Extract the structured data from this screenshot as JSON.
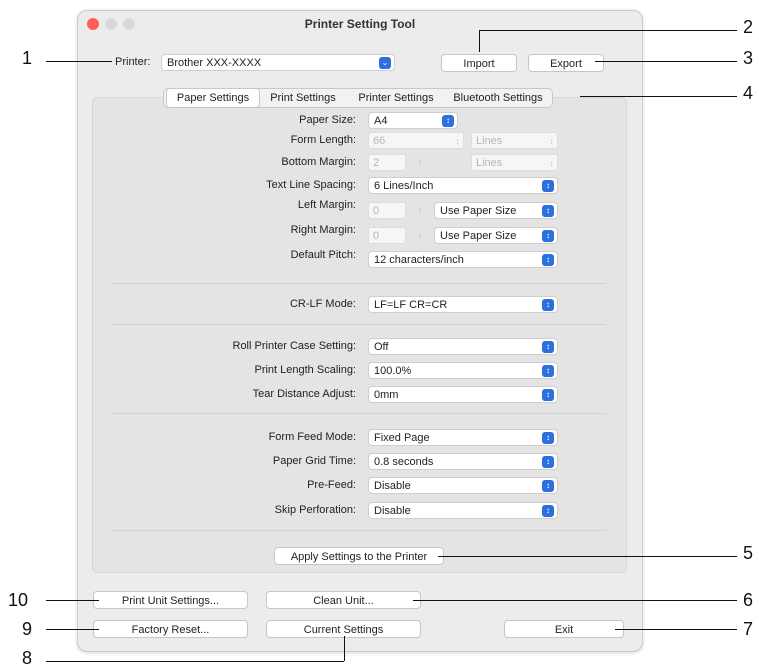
{
  "window": {
    "title": "Printer Setting Tool"
  },
  "printer": {
    "label": "Printer:",
    "value": "Brother XXX-XXXX"
  },
  "buttons": {
    "import": "Import",
    "export": "Export",
    "apply": "Apply Settings to the Printer",
    "print_unit": "Print Unit Settings...",
    "clean_unit": "Clean Unit...",
    "factory_reset": "Factory Reset...",
    "current_settings": "Current Settings",
    "exit": "Exit"
  },
  "tabs": [
    "Paper Settings",
    "Print Settings",
    "Printer Settings",
    "Bluetooth Settings"
  ],
  "settings": {
    "paper_size": {
      "label": "Paper Size:",
      "value": "A4"
    },
    "form_length": {
      "label": "Form Length:",
      "value": "66",
      "unit": "Lines"
    },
    "bottom_margin": {
      "label": "Bottom Margin:",
      "value": "2",
      "unit": "Lines"
    },
    "text_line_spacing": {
      "label": "Text Line Spacing:",
      "value": "6 Lines/Inch"
    },
    "left_margin": {
      "label": "Left Margin:",
      "value": "0",
      "mode": "Use Paper Size"
    },
    "right_margin": {
      "label": "Right Margin:",
      "value": "0",
      "mode": "Use Paper Size"
    },
    "default_pitch": {
      "label": "Default Pitch:",
      "value": "12 characters/inch"
    },
    "crlf_mode": {
      "label": "CR-LF Mode:",
      "value": "LF=LF CR=CR"
    },
    "roll_case": {
      "label": "Roll Printer Case Setting:",
      "value": "Off"
    },
    "print_length_scaling": {
      "label": "Print Length Scaling:",
      "value": "100.0%"
    },
    "tear_distance": {
      "label": "Tear Distance Adjust:",
      "value": "0mm"
    },
    "form_feed_mode": {
      "label": "Form Feed Mode:",
      "value": "Fixed Page"
    },
    "paper_grid_time": {
      "label": "Paper Grid Time:",
      "value": "0.8 seconds"
    },
    "pre_feed": {
      "label": "Pre-Feed:",
      "value": "Disable"
    },
    "skip_perforation": {
      "label": "Skip Perforation:",
      "value": "Disable"
    }
  },
  "callouts": [
    "1",
    "2",
    "3",
    "4",
    "5",
    "6",
    "7",
    "8",
    "9",
    "10"
  ],
  "colors": {
    "accent": "#2c6fe0",
    "close": "#ff5f57",
    "inactive_light": "#d8d8d8"
  }
}
